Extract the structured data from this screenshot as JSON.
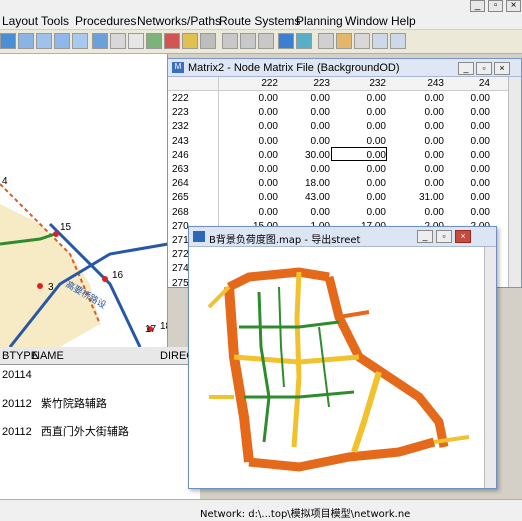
{
  "menubar": {
    "items": [
      "Layout",
      "Tools",
      "Procedures",
      "Networks/Paths",
      "Route Systems",
      "Planning",
      "Window",
      "Help"
    ]
  },
  "map_labels": {
    "nodes": [
      "4",
      "15",
      "16",
      "3",
      "17",
      "18"
    ],
    "road_text": "高要桥路设"
  },
  "bottom_table": {
    "headers": [
      "BTYPE",
      "NAME",
      "DIREC"
    ],
    "rows": [
      {
        "btype": "20114",
        "name": ""
      },
      {
        "btype": "20112",
        "name": "紫竹院路辅路"
      },
      {
        "btype": "20112",
        "name": "西直门外大街辅路"
      }
    ]
  },
  "matrix_window": {
    "title": "Matrix2 - Node Matrix File (BackgroundOD)",
    "col_headers": [
      "222",
      "223",
      "232",
      "243",
      "24"
    ],
    "row_headers": [
      "222",
      "223",
      "232",
      "243",
      "246",
      "263",
      "264",
      "265",
      "268",
      "270",
      "271",
      "272",
      "274",
      "275"
    ],
    "cells": [
      [
        "0.00",
        "0.00",
        "0.00",
        "0.00",
        "0.00"
      ],
      [
        "0.00",
        "0.00",
        "0.00",
        "0.00",
        "0.00"
      ],
      [
        "0.00",
        "0.00",
        "0.00",
        "0.00",
        "0.00"
      ],
      [
        "0.00",
        "0.00",
        "0.00",
        "0.00",
        "0.00"
      ],
      [
        "0.00",
        "30.00",
        "0.00",
        "0.00",
        "0.00"
      ],
      [
        "0.00",
        "0.00",
        "0.00",
        "0.00",
        "0.00"
      ],
      [
        "0.00",
        "18.00",
        "0.00",
        "0.00",
        "0.00"
      ],
      [
        "0.00",
        "43.00",
        "0.00",
        "31.00",
        "0.00"
      ],
      [
        "0.00",
        "0.00",
        "0.00",
        "0.00",
        "0.00"
      ],
      [
        "15.00",
        "1.00",
        "17.00",
        "2.00",
        "2.00"
      ],
      [
        "",
        "",
        "",
        "",
        ""
      ],
      [
        "",
        "",
        "",
        "",
        ""
      ],
      [
        "",
        "",
        "",
        "",
        ""
      ],
      [
        "",
        "",
        "",
        "",
        ""
      ]
    ]
  },
  "map2_window": {
    "title": "B背景负荷度图.map - 导出street"
  },
  "status_bar": {
    "text": "Network: d:\\...top\\模拟项目模型\\network.ne"
  },
  "colors": {
    "link_high": "#e5691a",
    "link_mid": "#f2c12e",
    "link_low": "#2e8b2e",
    "title_bg": "#dfe7f4"
  }
}
